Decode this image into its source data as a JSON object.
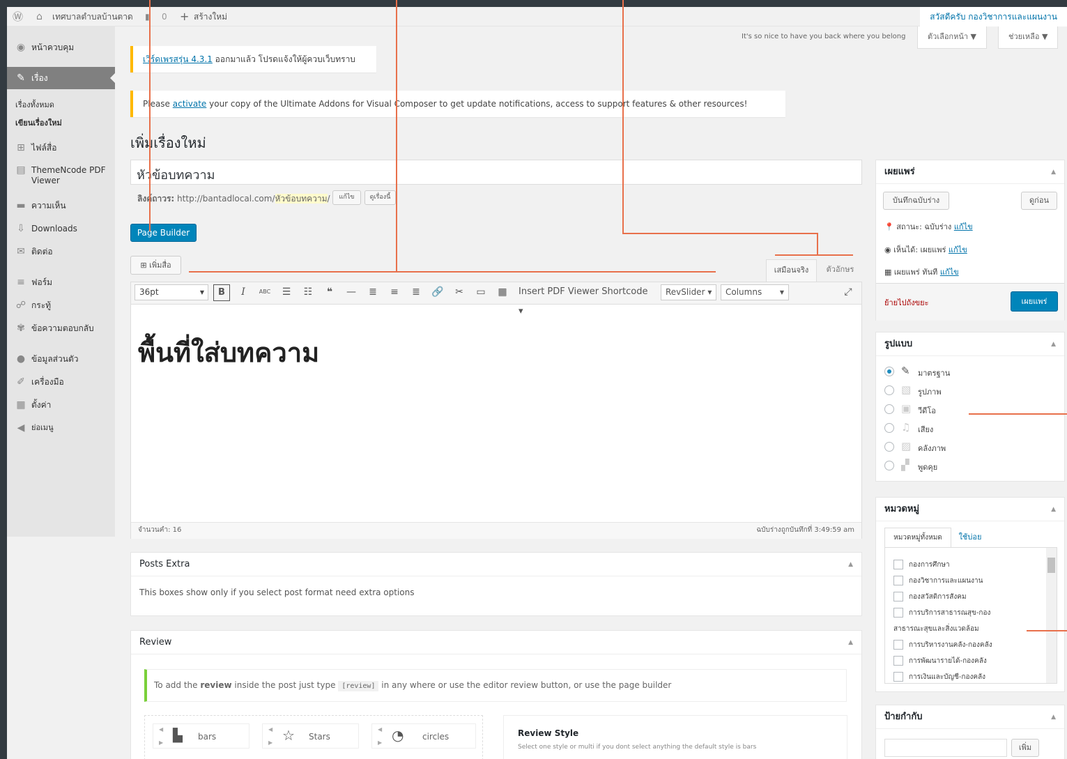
{
  "adminbar": {
    "site_name": "เทศบาลตำบลบ้านตาด",
    "comments_count": "0",
    "new_label": "สร้างใหม่",
    "howdy": "สวัสดีครับ กองวิชาการและแผนงาน"
  },
  "screen_meta": {
    "welcome_text": "It's so nice to have you back where you belong",
    "screen_options": "ตัวเลือกหน้า ▼",
    "help": "ช่วยเหลือ ▼"
  },
  "sidebar": {
    "items": [
      {
        "label": "หน้าควบคุม",
        "icon": "dashboard-icon"
      },
      {
        "label": "เรื่อง",
        "icon": "pin-icon"
      },
      {
        "label": "ไฟล์สื่อ",
        "icon": "media-icon"
      },
      {
        "label": "ThemeNcode PDF Viewer",
        "icon": "pdf-icon"
      },
      {
        "label": "ความเห็น",
        "icon": "comment-icon"
      },
      {
        "label": "Downloads",
        "icon": "download-icon"
      },
      {
        "label": "ติดต่อ",
        "icon": "mail-icon"
      },
      {
        "label": "ฟอร์ม",
        "icon": "form-icon"
      },
      {
        "label": "กระทู้",
        "icon": "forum-icon"
      },
      {
        "label": "ข้อความตอบกลับ",
        "icon": "reply-icon"
      },
      {
        "label": "ข้อมูลส่วนตัว",
        "icon": "user-icon"
      },
      {
        "label": "เครื่องมือ",
        "icon": "tools-icon"
      },
      {
        "label": "ตั้งค่า",
        "icon": "settings-icon"
      },
      {
        "label": "ย่อเมนู",
        "icon": "collapse-icon"
      }
    ],
    "sub": {
      "all_posts": "เรื่องทั้งหมด",
      "new_post": "เขียนเรื่องใหม่"
    }
  },
  "notices": {
    "update_link": "เวิร์ดเพรสรุ่น 4.3.1",
    "update_rest": " ออกมาแล้ว โปรดแจ้งให้ผู้ควบเว็บทราบ",
    "activate_pre": "Please ",
    "activate_link": "activate",
    "activate_rest": " your copy of the Ultimate Addons for Visual Composer to get update notifications, access to support features & other resources!"
  },
  "page_title": "เพิ่มเรื่องใหม่",
  "post_title": "หัวข้อบทความ",
  "permalink": {
    "label": "ลิงค์ถาวร:",
    "base": " http://bantadlocal.com/",
    "slug": "หัวข้อบทความ",
    "slash": "/",
    "edit": "แก้ไข",
    "view": "ดูเรื่องนี้"
  },
  "page_builder": "Page Builder",
  "add_media": "เพิ่มสื่อ",
  "editor_tabs": {
    "visual": "เสมือนจริง",
    "text": "ตัวอักษร"
  },
  "toolbar": {
    "font_size": "36pt",
    "pdf_shortcode": "Insert PDF Viewer Shortcode ▾",
    "revslider": "RevSlider ▾",
    "columns": "Columns"
  },
  "editor_content": "พื้นที่ใส่บทความ",
  "status_bar": {
    "word_count": "จำนวนคำ: 16",
    "saved": "ฉบับร่างถูกบันทึกที่ 3:49:59 am"
  },
  "posts_extra": {
    "title": "Posts Extra",
    "text": "This boxes show only if you select post format need extra options"
  },
  "review": {
    "title": "Review",
    "info_pre": "To add the ",
    "info_bold": "review",
    "info_mid": " inside the post just type ",
    "info_code": "[review]",
    "info_post": " in any where or use the editor review button, or use the page builder",
    "styles": [
      "bars",
      "Stars",
      "circles"
    ],
    "style_title": "Review Style",
    "style_desc": "Select one style or multi if you dont select anything the default style is bars"
  },
  "publish": {
    "title": "เผยแพร่",
    "save_draft": "บันทึกฉบับร่าง",
    "preview": "ดูก่อน",
    "status_label": "สถานะ: ฉบับร่าง",
    "visibility_label": "เห็นได้: เผยแพร่",
    "schedule_label": "เผยแพร่ ทันที",
    "edit": "แก้ไข",
    "trash": "ย้ายไปถังขยะ",
    "publish_btn": "เผยแพร่"
  },
  "format": {
    "title": "รูปแบบ",
    "options": [
      "มาตรฐาน",
      "รูปภาพ",
      "วีดีโอ",
      "เสียง",
      "คลังภาพ",
      "พูดคุย"
    ]
  },
  "categories": {
    "title": "หมวดหมู่",
    "tab_all": "หมวดหมู่ทั้งหมด",
    "tab_popular": "ใช้บ่อย",
    "items": [
      "กองการศึกษา",
      "กองวิชาการและแผนงาน",
      "กองสวัสดิการสังคม",
      "การบริการสาธารณสุข-กอง",
      "สาธารณะสุขและสิ่งแวดล้อม",
      "การบริหารงานคลัง-กองคลัง",
      "การพัฒนารายได้-กองคลัง",
      "การเงินและบัญชี-กองคลัง"
    ]
  },
  "tags": {
    "title": "ป้ายกำกับ",
    "add": "เพิ่ม"
  }
}
